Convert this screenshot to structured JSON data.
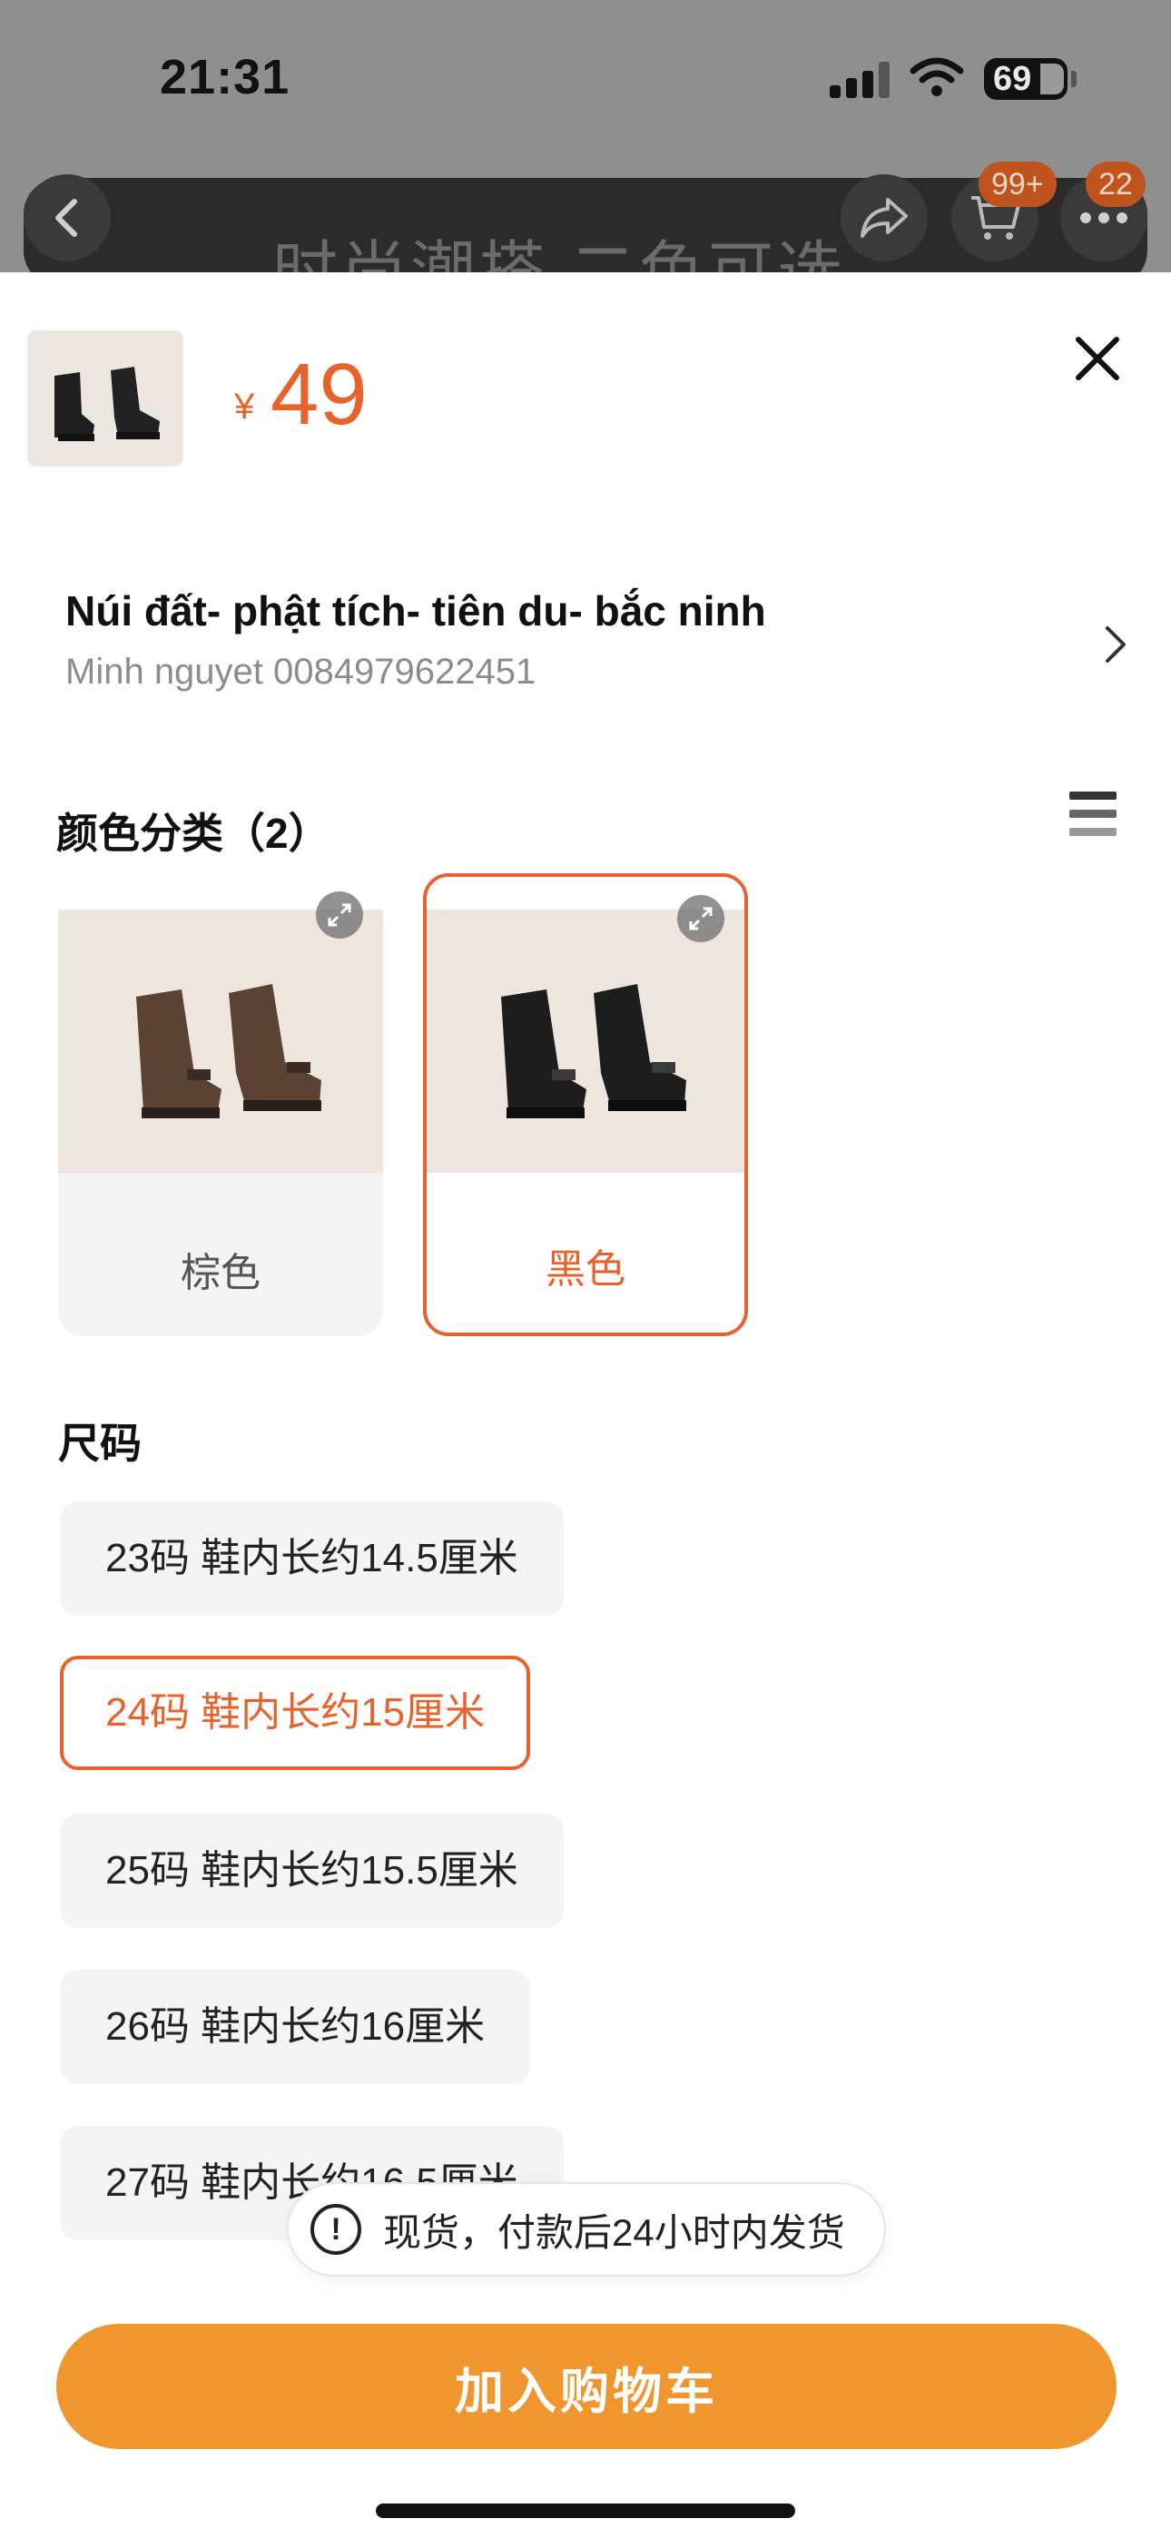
{
  "status_bar": {
    "time": "21:31",
    "battery": "69"
  },
  "background_nav": {
    "title": "时尚潮搭 二色可选",
    "cart_badge": "99+",
    "more_badge": "22"
  },
  "sheet": {
    "price_currency": "¥",
    "price": "49",
    "address": {
      "line": "Núi đất- phật tích- tiên du- bắc ninh",
      "contact": "Minh nguyet 0084979622451"
    },
    "color_section": {
      "title": "颜色分类（2）",
      "options": [
        {
          "label": "棕色",
          "selected": false,
          "boot_color": "#5a4334"
        },
        {
          "label": "黑色",
          "selected": true,
          "boot_color": "#1c1c1c"
        }
      ]
    },
    "size_section": {
      "title": "尺码",
      "options": [
        {
          "label": "23码 鞋内长约14.5厘米",
          "selected": false
        },
        {
          "label": "24码 鞋内长约15厘米",
          "selected": true
        },
        {
          "label": "25码 鞋内长约15.5厘米",
          "selected": false
        },
        {
          "label": "26码 鞋内长约16厘米",
          "selected": false
        },
        {
          "label": "27码 鞋内长约16.5厘米",
          "selected": false
        }
      ]
    },
    "stock_notice": "现货，付款后24小时内发货",
    "add_to_cart_label": "加入购物车"
  },
  "colors": {
    "accent": "#e8632b",
    "cart_button": "#f0962f"
  }
}
